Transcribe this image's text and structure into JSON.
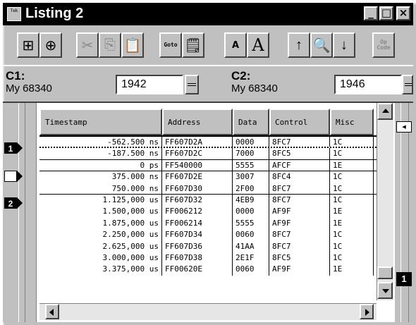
{
  "window": {
    "title": "Listing 2",
    "sys_icon_text": "Tek",
    "minimize": "_",
    "maximize": "□",
    "close": "×"
  },
  "toolbar": {
    "buttons": [
      {
        "name": "add-column",
        "glyph": "⊞"
      },
      {
        "name": "add-data",
        "glyph": "⊕"
      },
      {
        "name": "cut",
        "glyph": "✂"
      },
      {
        "name": "copy",
        "glyph": "⎘"
      },
      {
        "name": "paste",
        "glyph": "📋"
      },
      {
        "name": "goto",
        "text": "Goto"
      },
      {
        "name": "properties",
        "glyph": "🗒"
      },
      {
        "name": "font-smaller",
        "text": "A"
      },
      {
        "name": "font-larger",
        "text": "A"
      },
      {
        "name": "search-up",
        "glyph": "↑"
      },
      {
        "name": "find",
        "glyph": "🔍"
      },
      {
        "name": "search-down",
        "glyph": "↓"
      },
      {
        "name": "opcode",
        "text": "Op Code"
      }
    ]
  },
  "cursors": {
    "c1": {
      "label": "C1:",
      "source": "My 68340",
      "value": "1942"
    },
    "c2": {
      "label": "C2:",
      "source": "My 68340",
      "value": "1946"
    }
  },
  "table": {
    "columns": [
      "Timestamp",
      "Address",
      "Data",
      "Control",
      "Misc"
    ],
    "rows": [
      [
        "-562.500 ns",
        "FF607D2A",
        "0000",
        "8FC7",
        "1C"
      ],
      [
        "-187.500 ns",
        "FF607D2C",
        "7000",
        "8FC5",
        "1C"
      ],
      [
        "0 ps",
        "FF540000",
        "5555",
        "AFCF",
        "1E"
      ],
      [
        "375.000 ns",
        "FF607D2E",
        "3007",
        "8FC4",
        "1C"
      ],
      [
        "750.000 ns",
        "FF607D30",
        "2F00",
        "8FC7",
        "1C"
      ],
      [
        "1.125,000 us",
        "FF607D32",
        "4EB9",
        "8FC7",
        "1C"
      ],
      [
        "1.500,000 us",
        "FF006212",
        "0000",
        "AF9F",
        "1E"
      ],
      [
        "1.875,000 us",
        "FF006214",
        "5555",
        "AF9F",
        "1E"
      ],
      [
        "2.250,000 us",
        "FF607D34",
        "0060",
        "8FC7",
        "1C"
      ],
      [
        "2.625,000 us",
        "FF607D36",
        "41AA",
        "8FC7",
        "1C"
      ],
      [
        "3.000,000 us",
        "FF607D38",
        "2E1F",
        "8FC5",
        "1C"
      ],
      [
        "3.375,000 us",
        "FF00620E",
        "0060",
        "AF9F",
        "1E"
      ]
    ]
  },
  "markers": {
    "m1": "1",
    "m2": "2",
    "right": "1"
  }
}
